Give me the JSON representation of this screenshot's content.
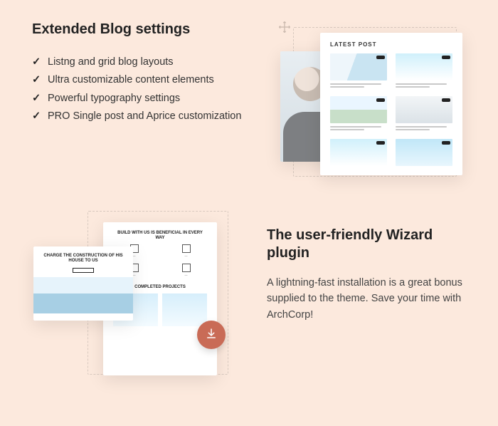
{
  "top": {
    "heading": "Extended Blog settings",
    "bullets": [
      "Listng and grid blog layouts",
      "Ultra customizable content elements",
      "Powerful typography settings",
      "PRO Single post and Aprice customization"
    ],
    "preview": {
      "latest_post_label": "LATEST POST"
    }
  },
  "bottom": {
    "heading": "The user-friendly Wizard plugin",
    "body": "A lightning-fast installation is a great bonus supplied to the theme. Save your time with ArchCorp!",
    "preview": {
      "hero_title": "BUILD WITH US IS BENEFICIAL IN EVERY WAY",
      "section_title": "COMPLETED PROJECTS",
      "back_title": "CHARGE THE CONSTRUCTION OF HIS HOUSE TO US"
    }
  }
}
